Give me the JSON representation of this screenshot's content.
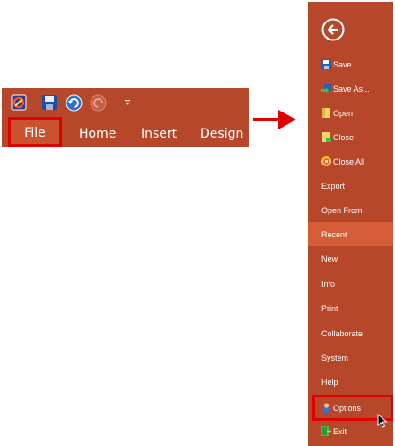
{
  "ribbon": {
    "tabs": [
      "File",
      "Home",
      "Insert",
      "Design"
    ],
    "qat": [
      "app-icon",
      "save-icon",
      "undo-icon",
      "redo-icon",
      "customize-chevron-icon"
    ]
  },
  "backstage": {
    "back_icon": "back-arrow-icon",
    "items": [
      {
        "label": "Save",
        "icon": "floppy-icon"
      },
      {
        "label": "Save As...",
        "icon": "save-as-icon"
      },
      {
        "label": "Open",
        "icon": "folder-icon"
      },
      {
        "label": "Close",
        "icon": "close-doc-icon"
      },
      {
        "label": "Close All",
        "icon": "close-all-icon"
      },
      {
        "label": "Export",
        "icon": ""
      },
      {
        "label": "Open From",
        "icon": ""
      },
      {
        "label": "Recent",
        "icon": "",
        "selected": true
      },
      {
        "label": "New",
        "icon": ""
      },
      {
        "label": "Info",
        "icon": ""
      },
      {
        "label": "Print",
        "icon": ""
      },
      {
        "label": "Collaborate",
        "icon": ""
      },
      {
        "label": "System",
        "icon": ""
      },
      {
        "label": "Help",
        "icon": ""
      },
      {
        "label": "Options",
        "icon": "user-options-icon",
        "highlighted": true
      },
      {
        "label": "Exit",
        "icon": "exit-icon"
      }
    ]
  },
  "colors": {
    "accent": "#b7472a",
    "selected": "#d65b37",
    "highlight": "#e00000"
  }
}
